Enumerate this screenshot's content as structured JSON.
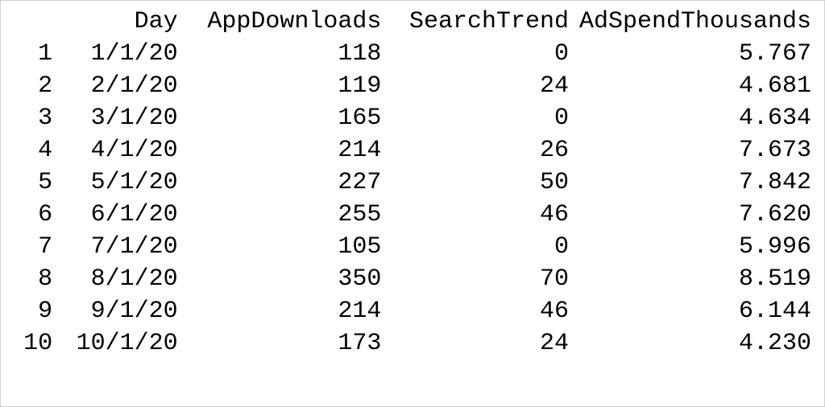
{
  "table": {
    "headers": {
      "index": "",
      "day": "Day",
      "app_downloads": "AppDownloads",
      "search_trend": "SearchTrend",
      "ad_spend": "AdSpendThousands"
    },
    "rows": [
      {
        "index": "1",
        "day": "1/1/20",
        "app_downloads": "118",
        "search_trend": "0",
        "ad_spend": "5.767"
      },
      {
        "index": "2",
        "day": "2/1/20",
        "app_downloads": "119",
        "search_trend": "24",
        "ad_spend": "4.681"
      },
      {
        "index": "3",
        "day": "3/1/20",
        "app_downloads": "165",
        "search_trend": "0",
        "ad_spend": "4.634"
      },
      {
        "index": "4",
        "day": "4/1/20",
        "app_downloads": "214",
        "search_trend": "26",
        "ad_spend": "7.673"
      },
      {
        "index": "5",
        "day": "5/1/20",
        "app_downloads": "227",
        "search_trend": "50",
        "ad_spend": "7.842"
      },
      {
        "index": "6",
        "day": "6/1/20",
        "app_downloads": "255",
        "search_trend": "46",
        "ad_spend": "7.620"
      },
      {
        "index": "7",
        "day": "7/1/20",
        "app_downloads": "105",
        "search_trend": "0",
        "ad_spend": "5.996"
      },
      {
        "index": "8",
        "day": "8/1/20",
        "app_downloads": "350",
        "search_trend": "70",
        "ad_spend": "8.519"
      },
      {
        "index": "9",
        "day": "9/1/20",
        "app_downloads": "214",
        "search_trend": "46",
        "ad_spend": "6.144"
      },
      {
        "index": "10",
        "day": "10/1/20",
        "app_downloads": "173",
        "search_trend": "24",
        "ad_spend": "4.230"
      }
    ]
  }
}
